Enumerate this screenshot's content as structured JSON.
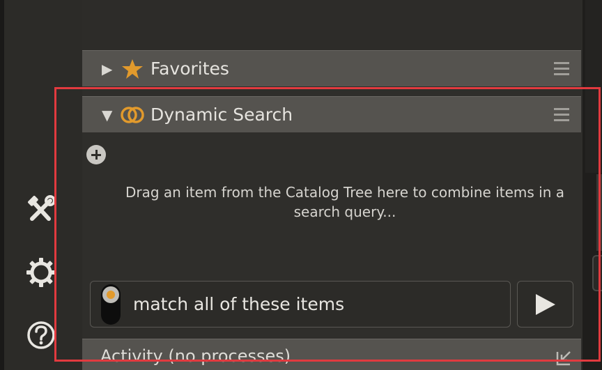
{
  "sidebar": {
    "tools_icon": "hammer-wrench-icon",
    "settings_icon": "gear-icon",
    "help_icon": "help-icon"
  },
  "favorites": {
    "label": "Favorites",
    "expanded": false,
    "icon": "star-icon"
  },
  "dynamic_search": {
    "label": "Dynamic Search",
    "expanded": true,
    "icon": "rings-icon",
    "hint": "Drag an item from the Catalog Tree here to combine items in a search query...",
    "match_label": "match all of these items",
    "run_icon": "play-icon"
  },
  "activity": {
    "label": "Activity (no processes)",
    "icon": "undock-icon"
  },
  "colors": {
    "accent": "#e29a2c",
    "highlight_box": "#e23a3f",
    "header_bg": "#55534f"
  }
}
